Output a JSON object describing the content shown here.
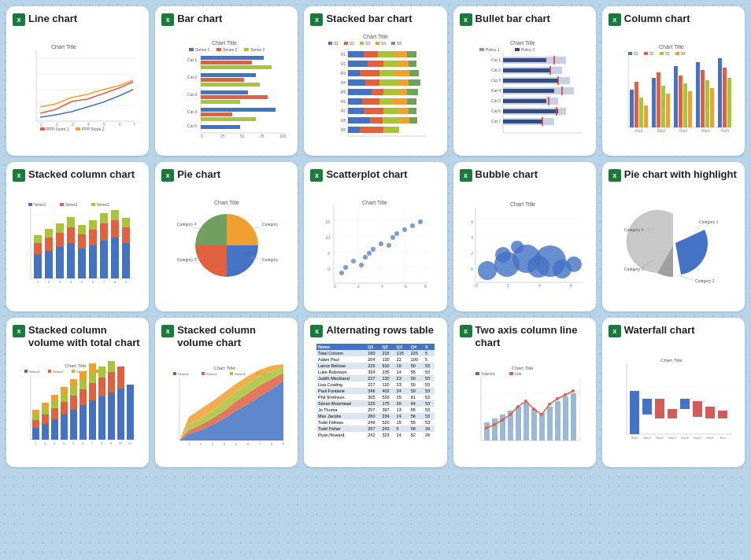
{
  "cards": [
    {
      "id": "line-chart",
      "title": "Line chart"
    },
    {
      "id": "bar-chart",
      "title": "Bar chart"
    },
    {
      "id": "stacked-bar-chart",
      "title": "Stacked bar chart"
    },
    {
      "id": "bullet-bar-chart",
      "title": "Bullet bar chart"
    },
    {
      "id": "column-chart",
      "title": "Column chart"
    },
    {
      "id": "stacked-column-chart",
      "title": "Stacked column chart"
    },
    {
      "id": "pie-chart",
      "title": "Pie chart"
    },
    {
      "id": "scatterplot-chart",
      "title": "Scatterplot chart"
    },
    {
      "id": "bubble-chart",
      "title": "Bubble chart"
    },
    {
      "id": "pie-chart-highlight",
      "title": "Pie chart with highlight"
    },
    {
      "id": "stacked-column-volume-total",
      "title": "Stacked column volume with total chart"
    },
    {
      "id": "stacked-column-volume",
      "title": "Stacked column volume chart"
    },
    {
      "id": "alternating-rows-table",
      "title": "Alternating rows table"
    },
    {
      "id": "two-axis-column-line",
      "title": "Two axis column line chart"
    },
    {
      "id": "waterfall-chart",
      "title": "Waterfall chart"
    }
  ],
  "table": {
    "headers": [
      "Name",
      "Q1",
      "Q2",
      "Q3",
      "Q4",
      "X"
    ],
    "rows": [
      [
        "Total Column",
        190,
        215,
        115,
        225,
        5
      ],
      [
        "Adam Paul",
        204,
        130,
        22,
        100,
        5
      ],
      [
        "Lance Belrose",
        225,
        910,
        19,
        50,
        53
      ],
      [
        "Luke Robinson",
        334,
        235,
        14,
        55,
        53
      ],
      [
        "Judith Meckland",
        227,
        120,
        23,
        50,
        53
      ],
      [
        "Lisa Cowling",
        227,
        120,
        23,
        50,
        53
      ],
      [
        "Paul Fontaine",
        346,
        402,
        24,
        50,
        53
      ],
      [
        "Phil Smithson",
        305,
        520,
        25,
        61,
        53
      ],
      [
        "Simon Moorhead",
        225,
        175,
        26,
        64,
        53
      ],
      [
        "Jo Thuma",
        257,
        397,
        13,
        65,
        53
      ],
      [
        "Max Jacobs",
        260,
        234,
        14,
        56,
        53
      ],
      [
        "Todd Fellows",
        246,
        520,
        15,
        55,
        53
      ],
      [
        "Todd Fisher",
        257,
        243,
        5,
        58,
        29
      ],
      [
        "Ryan Howard",
        242,
        323,
        14,
        52,
        29
      ]
    ]
  }
}
